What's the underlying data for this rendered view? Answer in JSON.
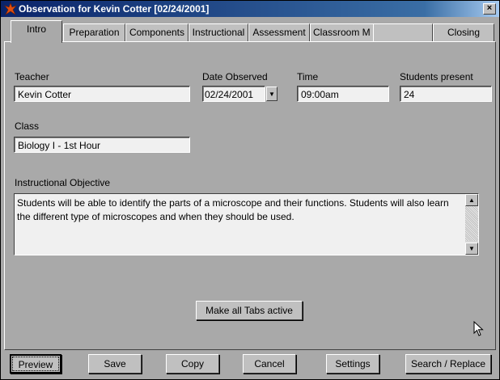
{
  "window": {
    "title": "Observation for Kevin Cotter  [02/24/2001]",
    "close_label": "×"
  },
  "tabs": [
    {
      "label": "Intro",
      "active": true
    },
    {
      "label": "Preparation"
    },
    {
      "label": "Components"
    },
    {
      "label": "Instructional"
    },
    {
      "label": "Assessment"
    },
    {
      "label": "Classroom M"
    },
    {
      "label": ""
    },
    {
      "label": "Closing"
    }
  ],
  "form": {
    "teacher_label": "Teacher",
    "teacher_value": "Kevin Cotter",
    "date_label": "Date Observed",
    "date_value": "02/24/2001",
    "time_label": "Time",
    "time_value": "09:00am",
    "students_label": "Students present",
    "students_value": "24",
    "class_label": "Class",
    "class_value": "Biology  I - 1st Hour",
    "objective_label": "Instructional Objective",
    "objective_value": "Students will be able to identify the parts of a microscope and their functions.  Students will also learn the different type of microscopes and when they should be used."
  },
  "make_tabs_active_label": "Make all Tabs active",
  "buttons": {
    "preview": "Preview",
    "save": "Save",
    "copy": "Copy",
    "cancel": "Cancel",
    "settings": "Settings",
    "search_replace": "Search / Replace"
  },
  "colors": {
    "titlebar_start": "#0a246a",
    "titlebar_end": "#a6caf0",
    "panel_bg": "#a9a9a9",
    "field_bg": "#f0f0f0"
  }
}
